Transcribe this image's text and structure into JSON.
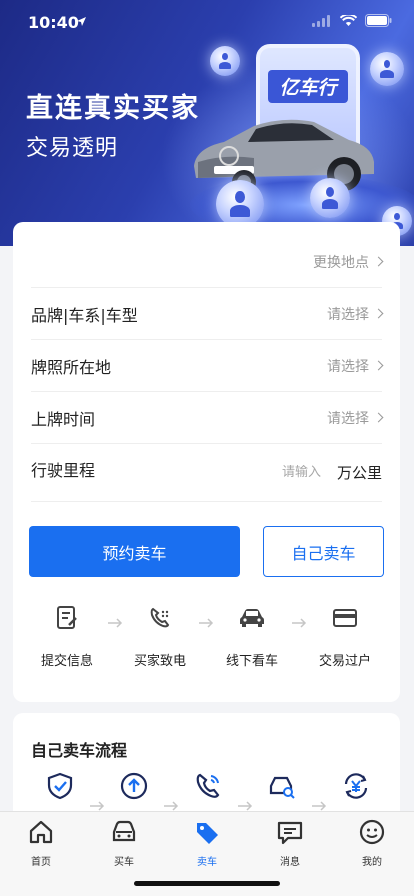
{
  "status_bar": {
    "time": "10:40"
  },
  "hero": {
    "headline": "直连真实买家",
    "subline": "交易透明",
    "brand": "亿车行"
  },
  "form": {
    "location_action": "更换地点",
    "rows": [
      {
        "label": "品牌|车系|车型",
        "value": "请选择"
      },
      {
        "label": "牌照所在地",
        "value": "请选择"
      },
      {
        "label": "上牌时间",
        "value": "请选择"
      }
    ],
    "mileage": {
      "label": "行驶里程",
      "placeholder": "请输入",
      "unit": "万公里"
    }
  },
  "buttons": {
    "primary": "预约卖车",
    "secondary": "自己卖车"
  },
  "steps": [
    {
      "label": "提交信息",
      "icon": "form-icon"
    },
    {
      "label": "买家致电",
      "icon": "phone-icon"
    },
    {
      "label": "线下看车",
      "icon": "car-icon"
    },
    {
      "label": "交易过户",
      "icon": "card-icon"
    }
  ],
  "self_sell": {
    "title": "自己卖车流程",
    "icons": [
      "shield-check-icon",
      "upload-icon",
      "phone-call-icon",
      "car-search-icon",
      "yuan-exchange-icon"
    ]
  },
  "tabbar": [
    {
      "label": "首页",
      "icon": "home-icon",
      "active": false
    },
    {
      "label": "买车",
      "icon": "car-icon",
      "active": false
    },
    {
      "label": "卖车",
      "icon": "tag-icon",
      "active": true
    },
    {
      "label": "消息",
      "icon": "message-icon",
      "active": false
    },
    {
      "label": "我的",
      "icon": "user-icon",
      "active": false
    }
  ],
  "colors": {
    "accent": "#1a6ff0",
    "hero": "#2b3fae"
  }
}
